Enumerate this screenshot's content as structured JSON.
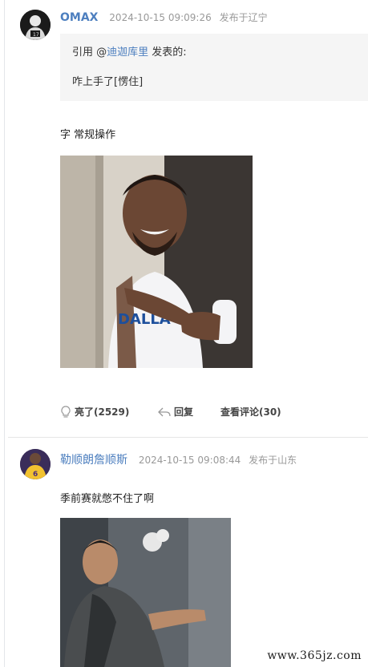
{
  "posts": [
    {
      "username": "OMAX",
      "time": "2024-10-15 09:09:26",
      "location": "发布于辽宁",
      "quote": {
        "prefix": "引用 @",
        "quoted_user": "迪迦库里",
        "suffix": " 发表的:",
        "text": "咋上手了[愣住]"
      },
      "text": "字 常规操作",
      "actions": {
        "like_label": "亮了(2529)",
        "reply_label": "回复",
        "comments_label": "查看评论(30)"
      }
    },
    {
      "username": "勒顺朗詹顺斯",
      "time": "2024-10-15 09:08:44",
      "location": "发布于山东",
      "text": "季前赛就憋不住了啊"
    }
  ],
  "watermark": "www.365jz.com",
  "colors": {
    "username": "#4d7fbf",
    "meta": "#999999",
    "quote_bg": "#f5f5f5"
  }
}
